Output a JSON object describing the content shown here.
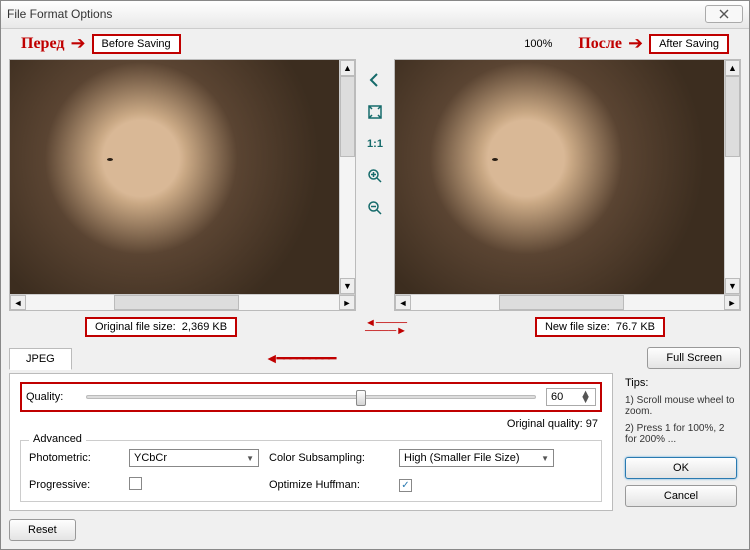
{
  "window": {
    "title": "File Format Options"
  },
  "annotations": {
    "before_ru": "Перед",
    "before_label": "Before Saving",
    "after_ru": "После",
    "after_label": "After Saving",
    "zoom_pct": "100%"
  },
  "sizes": {
    "original_label": "Original file size:",
    "original_value": "2,369 KB",
    "new_label": "New file size:",
    "new_value": "76.7 KB"
  },
  "tools": {
    "ratio": "1:1"
  },
  "tab": {
    "jpeg": "JPEG"
  },
  "buttons": {
    "full_screen": "Full Screen",
    "ok": "OK",
    "cancel": "Cancel",
    "reset": "Reset"
  },
  "quality": {
    "label": "Quality:",
    "value": "60",
    "original_quality": "Original quality: 97"
  },
  "advanced": {
    "legend": "Advanced",
    "photometric_label": "Photometric:",
    "photometric_value": "YCbCr",
    "progressive_label": "Progressive:",
    "subsampling_label": "Color Subsampling:",
    "subsampling_value": "High (Smaller File Size)",
    "huffman_label": "Optimize Huffman:"
  },
  "tips": {
    "head": "Tips:",
    "line1": "1) Scroll mouse wheel to zoom.",
    "line2": "2) Press 1 for 100%, 2 for 200% ..."
  }
}
